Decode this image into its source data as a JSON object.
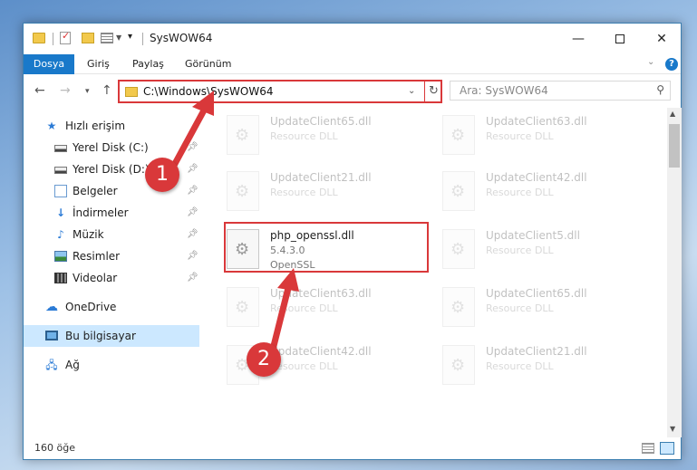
{
  "window": {
    "title": "SysWOW64",
    "controls": {
      "minimize": "—",
      "maximize": "",
      "close": "✕"
    }
  },
  "ribbon": {
    "tabs": [
      "Dosya",
      "Giriş",
      "Paylaş",
      "Görünüm"
    ]
  },
  "address_bar": {
    "path": "C:\\Windows\\SysWOW64"
  },
  "search": {
    "placeholder": "Ara: SysWOW64"
  },
  "sidebar": {
    "items": [
      {
        "label": "Hızlı erişim",
        "icon": "star-icon",
        "pinned": false
      },
      {
        "label": "Yerel Disk (C:)",
        "icon": "drive-icon",
        "pinned": true
      },
      {
        "label": "Yerel Disk (D:)",
        "icon": "drive-icon",
        "pinned": true
      },
      {
        "label": "Belgeler",
        "icon": "documents-icon",
        "pinned": true
      },
      {
        "label": "İndirmeler",
        "icon": "downloads-icon",
        "pinned": true
      },
      {
        "label": "Müzik",
        "icon": "music-icon",
        "pinned": true
      },
      {
        "label": "Resimler",
        "icon": "pictures-icon",
        "pinned": true
      },
      {
        "label": "Videolar",
        "icon": "videos-icon",
        "pinned": true
      },
      {
        "label": "OneDrive",
        "icon": "onedrive-icon",
        "pinned": false
      },
      {
        "label": "Bu bilgisayar",
        "icon": "this-pc-icon",
        "pinned": false,
        "selected": true
      },
      {
        "label": "Ağ",
        "icon": "network-icon",
        "pinned": false
      }
    ]
  },
  "files": [
    {
      "name": "UpdateClient65.dll",
      "line2": "Resource DLL",
      "line3": "",
      "faded": true
    },
    {
      "name": "UpdateClient63.dll",
      "line2": "Resource DLL",
      "line3": "",
      "faded": true
    },
    {
      "name": "UpdateClient21.dll",
      "line2": "Resource DLL",
      "line3": "",
      "faded": true
    },
    {
      "name": "UpdateClient42.dll",
      "line2": "Resource DLL",
      "line3": "",
      "faded": true
    },
    {
      "name": "php_openssl.dll",
      "line2": "5.4.3.0",
      "line3": "OpenSSL",
      "faded": false
    },
    {
      "name": "UpdateClient5.dll",
      "line2": "Resource DLL",
      "line3": "",
      "faded": true
    },
    {
      "name": "UpdateClient63.dll",
      "line2": "Resource DLL",
      "line3": "",
      "faded": true
    },
    {
      "name": "UpdateClient65.dll",
      "line2": "Resource DLL",
      "line3": "",
      "faded": true
    },
    {
      "name": "UpdateClient42.dll",
      "line2": "Resource DLL",
      "line3": "",
      "faded": true
    },
    {
      "name": "UpdateClient21.dll",
      "line2": "Resource DLL",
      "line3": "",
      "faded": true
    }
  ],
  "status": {
    "item_count": "160 öğe"
  },
  "annotations": {
    "step1": "1",
    "step2": "2",
    "color": "#d9383a"
  }
}
